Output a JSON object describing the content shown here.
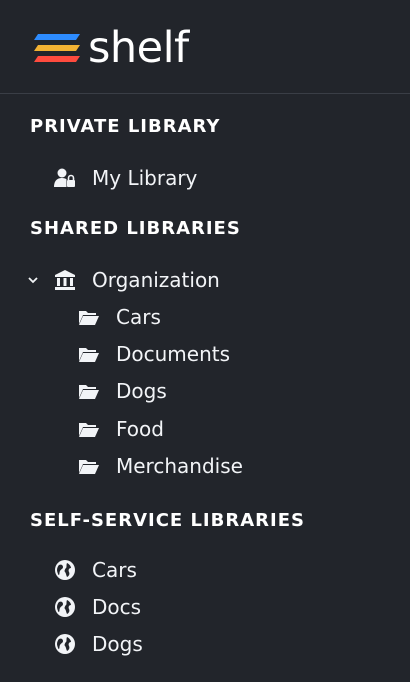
{
  "brand": {
    "name": "shelf",
    "logo_colors": [
      "#2d8cff",
      "#f2b233",
      "#ff4b3e"
    ]
  },
  "sections": {
    "private": {
      "title": "PRIVATE LIBRARY",
      "items": [
        {
          "label": "My Library",
          "icon": "user-lock-icon"
        }
      ]
    },
    "shared": {
      "title": "SHARED LIBRARIES",
      "root": {
        "label": "Organization",
        "icon": "bank-icon",
        "expanded": true
      },
      "items": [
        {
          "label": "Cars",
          "icon": "folder-open-icon"
        },
        {
          "label": "Documents",
          "icon": "folder-open-icon"
        },
        {
          "label": "Dogs",
          "icon": "folder-open-icon"
        },
        {
          "label": "Food",
          "icon": "folder-open-icon"
        },
        {
          "label": "Merchandise",
          "icon": "folder-open-icon"
        }
      ]
    },
    "self_service": {
      "title": "SELF-SERVICE LIBRARIES",
      "items": [
        {
          "label": "Cars",
          "icon": "globe-icon"
        },
        {
          "label": "Docs",
          "icon": "globe-icon"
        },
        {
          "label": "Dogs",
          "icon": "globe-icon"
        }
      ]
    }
  },
  "colors": {
    "background": "#22252b",
    "text": "#f2f4f7",
    "divider": "#3a3e46"
  }
}
